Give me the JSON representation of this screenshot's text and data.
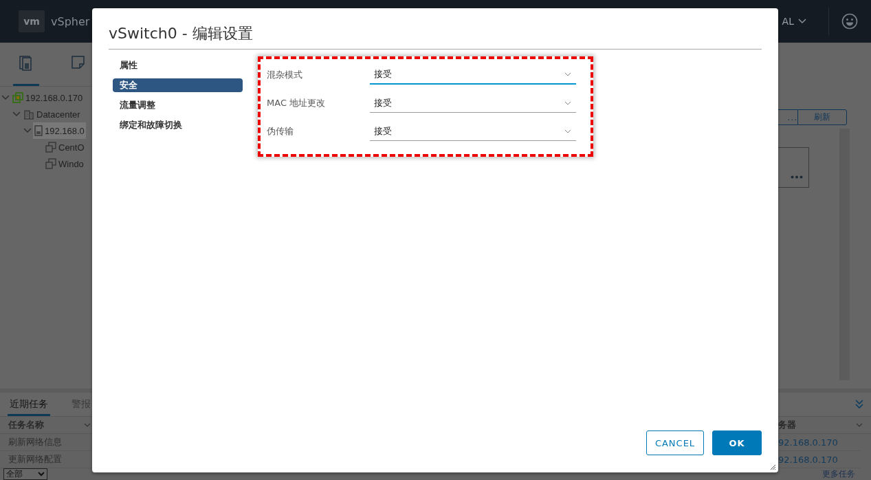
{
  "app_bar": {
    "logo": "vm",
    "product": "vSpher",
    "user_menu": "AL"
  },
  "nav_tabs": [
    {
      "kind": "hosts",
      "selected": true
    },
    {
      "kind": "storage",
      "selected": false
    }
  ],
  "tree": [
    {
      "kind": "host",
      "label": "192.168.0.170",
      "expanded": true,
      "selected": false,
      "children": [
        {
          "kind": "datacenter",
          "label": "Datacenter",
          "expanded": true,
          "selected": false,
          "children": [
            {
              "kind": "server",
              "label": "192.168.0",
              "expanded": true,
              "selected": true,
              "children": [
                {
                  "kind": "vm",
                  "label": "CentO",
                  "selected": false
                },
                {
                  "kind": "vm",
                  "label": "Windo",
                  "selected": false
                }
              ]
            }
          ]
        }
      ]
    }
  ],
  "toolbar": {
    "buttons": [
      "...",
      "刷新"
    ]
  },
  "dialog": {
    "title": "vSwitch0 - 编辑设置",
    "sections": [
      {
        "label": "属性",
        "selected": false
      },
      {
        "label": "安全",
        "selected": true
      },
      {
        "label": "流量调整",
        "selected": false
      },
      {
        "label": "绑定和故障切换",
        "selected": false
      }
    ],
    "settings": [
      {
        "label": "混杂模式",
        "value": "接受",
        "focused": true
      },
      {
        "label": "MAC 地址更改",
        "value": "接受",
        "focused": false
      },
      {
        "label": "伪传输",
        "value": "接受",
        "focused": false
      }
    ],
    "buttons": [
      {
        "label": "CANCEL",
        "kind": "secondary"
      },
      {
        "label": "OK",
        "kind": "primary"
      }
    ]
  },
  "tasks_panel": {
    "tabs": [
      {
        "label": "近期任务",
        "selected": true
      },
      {
        "label": "警报",
        "selected": false
      }
    ],
    "columns": [
      "任务名称",
      "务器"
    ],
    "rows": [
      {
        "task": "刷新网络信息",
        "server": "92.168.0.170"
      },
      {
        "task": "更新网络配置",
        "server": "92.168.0.170"
      }
    ],
    "filter": "全部",
    "more_link": "更多任务"
  }
}
